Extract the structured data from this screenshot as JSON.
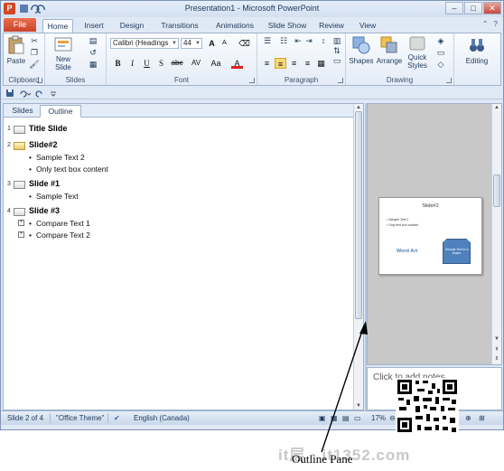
{
  "window": {
    "title": "Presentation1 - Microsoft PowerPoint",
    "app_icon": "P",
    "controls": [
      "–",
      "□",
      "✕"
    ]
  },
  "ribbon_tabs": [
    "Home",
    "Insert",
    "Design",
    "Transitions",
    "Animations",
    "Slide Show",
    "Review",
    "View"
  ],
  "file_tab": "File",
  "active_tab": "Home",
  "ribbon": {
    "clipboard": {
      "paste": "Paste",
      "label": "Clipboard"
    },
    "slides": {
      "new_slide_line1": "New",
      "new_slide_line2": "Slide",
      "label": "Slides"
    },
    "font": {
      "name": "Calibri (Headings",
      "size": "44",
      "label": "Font",
      "bold": "B",
      "italic": "I",
      "underline": "U",
      "shadow": "S",
      "strike": "abc",
      "spacing": "AV",
      "case": "Aa",
      "color": "A",
      "grow": "A",
      "shrink": "A"
    },
    "paragraph": {
      "label": "Paragraph"
    },
    "drawing": {
      "shapes": "Shapes",
      "arrange": "Arrange",
      "quick_styles_line1": "Quick",
      "quick_styles_line2": "Styles",
      "label": "Drawing"
    },
    "editing": {
      "label": "Editing"
    }
  },
  "pane_tabs": {
    "slides": "Slides",
    "outline": "Outline",
    "active": "Outline"
  },
  "outline": [
    {
      "num": "1",
      "title": "Title Slide",
      "bullets": []
    },
    {
      "num": "2",
      "title": "Slide#2",
      "bullets": [
        "Sample Text 2",
        "Only text box content"
      ]
    },
    {
      "num": "3",
      "title": "Slide #1",
      "bullets": [
        "Sample Text"
      ]
    },
    {
      "num": "4",
      "title": "Slide #3",
      "bullets": [
        "Compare Text 1",
        "Compare Text 2"
      ]
    }
  ],
  "slide_preview": {
    "title": "Slide#2",
    "bullets": [
      "Sample Text 2",
      "Only text box content"
    ],
    "wordart": "Word Art",
    "shape_text": "Sample Text in a shape"
  },
  "notes_placeholder": "Click to add notes",
  "status_bar": {
    "slide_info": "Slide 2 of 4",
    "theme": "\"Office Theme\"",
    "language": "English (Canada)",
    "zoom": "17%"
  },
  "annotation": {
    "label": "Outline Pane",
    "watermark": "it层 · it1352.com"
  }
}
